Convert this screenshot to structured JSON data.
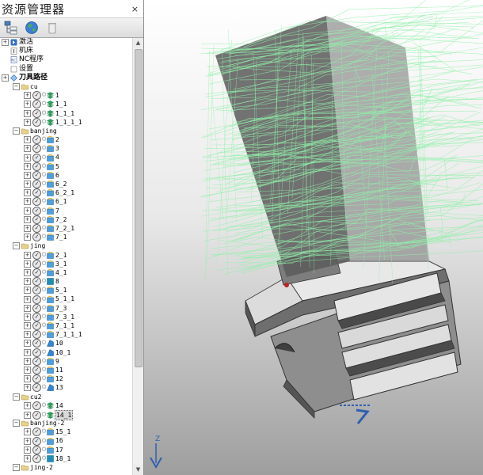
{
  "explorer": {
    "title": "资源管理器",
    "close_label": "×",
    "toolbar": [
      {
        "icon": "tree-view-icon"
      },
      {
        "icon": "globe-icon"
      },
      {
        "icon": "trash-icon"
      }
    ],
    "tree": [
      {
        "level": 0,
        "type": "root",
        "icon": "activate-icon",
        "label": "激活"
      },
      {
        "level": 0,
        "type": "root",
        "icon": "machine-icon",
        "label": "机床"
      },
      {
        "level": 0,
        "type": "root",
        "icon": "nc-program-icon",
        "label": "NC程序"
      },
      {
        "level": 0,
        "type": "root",
        "icon": "settings-icon",
        "label": "设置"
      },
      {
        "level": 0,
        "type": "root",
        "icon": "toolpath-icon",
        "label": "刀具路径",
        "bold": true
      },
      {
        "level": 1,
        "type": "folder",
        "label": "cu"
      },
      {
        "level": 2,
        "type": "path",
        "icon": "layer-icon",
        "label": "1"
      },
      {
        "level": 2,
        "type": "path",
        "icon": "layer-icon",
        "label": "1_1"
      },
      {
        "level": 2,
        "type": "path",
        "icon": "layer-icon",
        "label": "1_1_1"
      },
      {
        "level": 2,
        "type": "path",
        "icon": "layer-icon",
        "label": "1_1_1_1"
      },
      {
        "level": 1,
        "type": "folder",
        "label": "banjing"
      },
      {
        "level": 2,
        "type": "path",
        "icon": "profile-icon",
        "label": "2"
      },
      {
        "level": 2,
        "type": "path",
        "icon": "profile-icon",
        "label": "3"
      },
      {
        "level": 2,
        "type": "path",
        "icon": "profile-icon",
        "label": "4"
      },
      {
        "level": 2,
        "type": "path",
        "icon": "profile-icon",
        "label": "5"
      },
      {
        "level": 2,
        "type": "path",
        "icon": "profile-icon",
        "label": "6"
      },
      {
        "level": 2,
        "type": "path",
        "icon": "profile-icon",
        "label": "6_2"
      },
      {
        "level": 2,
        "type": "path",
        "icon": "profile-icon",
        "label": "6_2_1"
      },
      {
        "level": 2,
        "type": "path",
        "icon": "profile-icon",
        "label": "6_1"
      },
      {
        "level": 2,
        "type": "path",
        "icon": "profile-icon",
        "label": "7"
      },
      {
        "level": 2,
        "type": "path",
        "icon": "profile-icon",
        "label": "7_2"
      },
      {
        "level": 2,
        "type": "path",
        "icon": "profile-icon",
        "label": "7_2_1"
      },
      {
        "level": 2,
        "type": "path",
        "icon": "profile-icon",
        "label": "7_1"
      },
      {
        "level": 1,
        "type": "folder",
        "label": "jing"
      },
      {
        "level": 2,
        "type": "path",
        "icon": "profile-icon",
        "label": "2_1"
      },
      {
        "level": 2,
        "type": "path",
        "icon": "profile-icon",
        "label": "3_1"
      },
      {
        "level": 2,
        "type": "path",
        "icon": "profile-icon",
        "label": "4_1"
      },
      {
        "level": 2,
        "type": "path",
        "icon": "surface-icon",
        "label": "8"
      },
      {
        "level": 2,
        "type": "path",
        "icon": "profile-icon",
        "label": "5_1"
      },
      {
        "level": 2,
        "type": "path",
        "icon": "profile-icon",
        "label": "5_1_1"
      },
      {
        "level": 2,
        "type": "path",
        "icon": "profile-icon",
        "label": "7_3"
      },
      {
        "level": 2,
        "type": "path",
        "icon": "profile-icon",
        "label": "7_3_1"
      },
      {
        "level": 2,
        "type": "path",
        "icon": "profile-icon",
        "label": "7_1_1"
      },
      {
        "level": 2,
        "type": "path",
        "icon": "profile-icon",
        "label": "7_1_1_1"
      },
      {
        "level": 2,
        "type": "path",
        "icon": "swarf-icon",
        "label": "10"
      },
      {
        "level": 2,
        "type": "path",
        "icon": "swarf-icon",
        "label": "10_1"
      },
      {
        "level": 2,
        "type": "path",
        "icon": "profile-icon",
        "label": "9"
      },
      {
        "level": 2,
        "type": "path",
        "icon": "profile-icon",
        "label": "11"
      },
      {
        "level": 2,
        "type": "path",
        "icon": "profile-icon",
        "label": "12"
      },
      {
        "level": 2,
        "type": "path",
        "icon": "swarf-icon",
        "label": "13"
      },
      {
        "level": 1,
        "type": "folder",
        "label": "cu2"
      },
      {
        "level": 2,
        "type": "path",
        "icon": "layer-icon",
        "label": "14",
        "flag": "warning"
      },
      {
        "level": 2,
        "type": "path",
        "icon": "layer-icon",
        "label": "14_1",
        "selected": true
      },
      {
        "level": 1,
        "type": "folder",
        "label": "banjing-2"
      },
      {
        "level": 2,
        "type": "path",
        "icon": "profile-icon",
        "label": "15_1",
        "flag": "tool"
      },
      {
        "level": 2,
        "type": "path",
        "icon": "profile-icon",
        "label": "16"
      },
      {
        "level": 2,
        "type": "path",
        "icon": "profile-icon",
        "label": "17",
        "flag": "tool"
      },
      {
        "level": 2,
        "type": "path",
        "icon": "surface-icon",
        "label": "18_1"
      },
      {
        "level": 1,
        "type": "folder",
        "label": "jing-2"
      }
    ]
  },
  "viewport": {
    "axis_label": "Z",
    "colors": {
      "toolpath": "#90f0a8",
      "part_light": "#e8e8e8",
      "part_mid": "#9a9a9a",
      "part_dark": "#4a4a4a"
    }
  }
}
